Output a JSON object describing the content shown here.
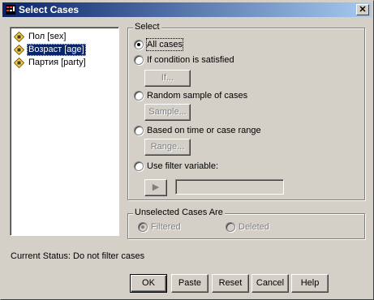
{
  "window": {
    "title": "Select Cases",
    "close_glyph": "✕"
  },
  "variables": [
    {
      "label": "Пол [sex]",
      "icon": "scale-variable-icon",
      "selected": false
    },
    {
      "label": "Возраст [age]",
      "icon": "scale-variable-icon",
      "selected": true
    },
    {
      "label": "Партия [party]",
      "icon": "scale-variable-icon",
      "selected": false
    }
  ],
  "select": {
    "legend": "Select",
    "options": [
      {
        "label": "All cases",
        "checked": true,
        "button": null
      },
      {
        "label": "If condition is satisfied",
        "checked": false,
        "button": "If..."
      },
      {
        "label": "Random sample of cases",
        "checked": false,
        "button": "Sample..."
      },
      {
        "label": "Based on time or case range",
        "checked": false,
        "button": "Range..."
      },
      {
        "label": "Use filter variable:",
        "checked": false,
        "button": null
      }
    ],
    "arrow_glyph": "▶",
    "filter_value": ""
  },
  "unselected": {
    "legend": "Unselected Cases Are",
    "filtered": "Filtered",
    "deleted": "Deleted",
    "selected_option": "Filtered"
  },
  "status": {
    "text": "Current Status: Do not filter cases"
  },
  "buttons": {
    "ok": "OK",
    "paste": "Paste",
    "reset": "Reset",
    "cancel": "Cancel",
    "help": "Help"
  },
  "colors": {
    "titlebar_start": "#0a246a",
    "titlebar_end": "#a6caf0",
    "selection": "#0a246a",
    "face": "#d4d0c8"
  }
}
